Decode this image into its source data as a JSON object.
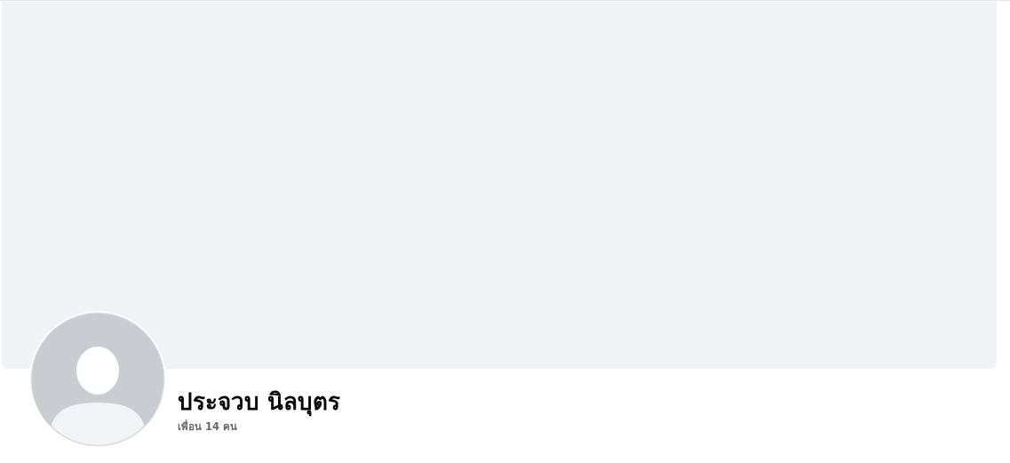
{
  "profile": {
    "name": "ประจวบ นิลบุตร",
    "friends": "เพื่อน 14 คน"
  }
}
